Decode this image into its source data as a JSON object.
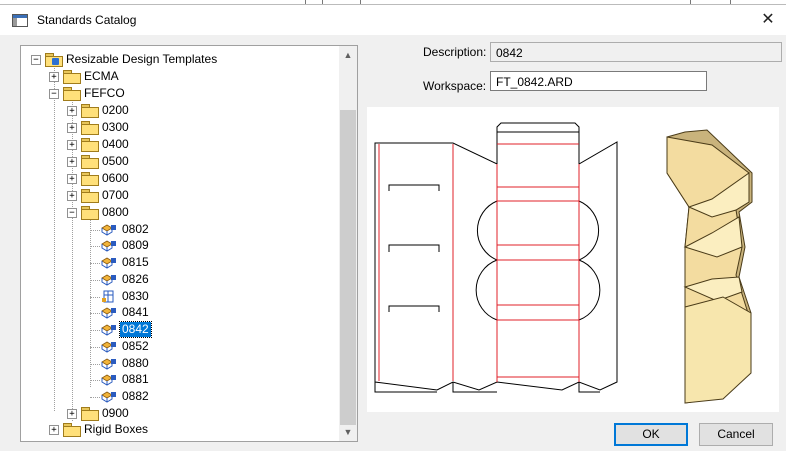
{
  "window": {
    "title": "Standards Catalog",
    "close_glyph": "✕"
  },
  "tree": {
    "nodes": [
      {
        "label": "Resizable Design Templates",
        "expander": "−",
        "icon": "root-folder-icon"
      },
      {
        "label": "ECMA",
        "expander": "+",
        "icon": "folder-icon"
      },
      {
        "label": "FEFCO",
        "expander": "−",
        "icon": "folder-icon"
      },
      {
        "label": "0200",
        "expander": "+",
        "icon": "folder-icon"
      },
      {
        "label": "0300",
        "expander": "+",
        "icon": "folder-icon"
      },
      {
        "label": "0400",
        "expander": "+",
        "icon": "folder-icon"
      },
      {
        "label": "0500",
        "expander": "+",
        "icon": "folder-icon"
      },
      {
        "label": "0600",
        "expander": "+",
        "icon": "folder-icon"
      },
      {
        "label": "0700",
        "expander": "+",
        "icon": "folder-icon"
      },
      {
        "label": "0800",
        "expander": "−",
        "icon": "folder-icon"
      },
      {
        "label": "0802",
        "icon": "design-template-icon"
      },
      {
        "label": "0809",
        "icon": "design-template-icon"
      },
      {
        "label": "0815",
        "icon": "design-template-icon"
      },
      {
        "label": "0826",
        "icon": "design-template-icon"
      },
      {
        "label": "0830",
        "icon": "layout-template-icon"
      },
      {
        "label": "0841",
        "icon": "design-template-icon"
      },
      {
        "label": "0842",
        "icon": "design-template-icon",
        "selected": true
      },
      {
        "label": "0852",
        "icon": "design-template-icon"
      },
      {
        "label": "0880",
        "icon": "design-template-icon"
      },
      {
        "label": "0881",
        "icon": "design-template-icon"
      },
      {
        "label": "0882",
        "icon": "design-template-icon"
      },
      {
        "label": "0900",
        "expander": "+",
        "icon": "folder-icon"
      },
      {
        "label": "Rigid Boxes",
        "expander": "+",
        "icon": "folder-icon"
      }
    ],
    "scroll_up_glyph": "▲",
    "scroll_down_glyph": "▼"
  },
  "details": {
    "description_label": "Description:",
    "description_value": "0842",
    "workspace_label": "Workspace:",
    "workspace_value": "FT_0842.ARD"
  },
  "buttons": {
    "ok": "OK",
    "cancel": "Cancel"
  },
  "colors": {
    "selection": "#0078d7",
    "cut_line": "#000000",
    "crease_line": "#e0202a",
    "cardboard_light": "#fbeec0",
    "cardboard_dark": "#c9b37c"
  }
}
